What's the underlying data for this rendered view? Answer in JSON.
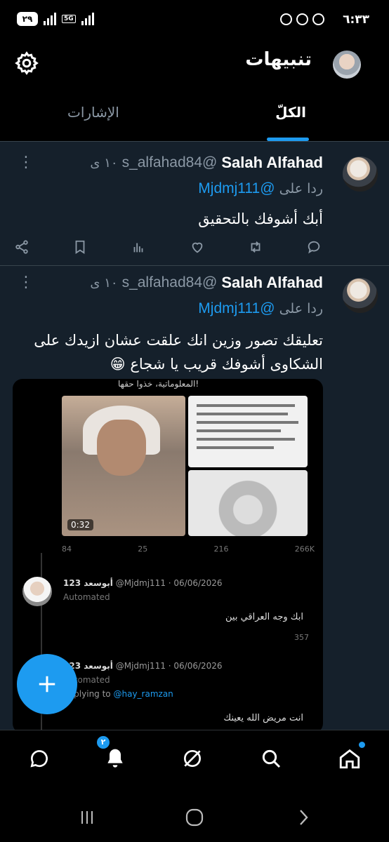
{
  "status_bar": {
    "time": "٦:٣٣",
    "battery": "٢٩",
    "network_label": "5G",
    "left_icons": [
      "alarm-icon",
      "whatsapp-icon",
      "whatsapp-icon"
    ]
  },
  "header": {
    "title": "تنبيهات",
    "tabs": [
      {
        "label": "الكلّ",
        "active": true
      },
      {
        "label": "الإشارات",
        "active": false
      }
    ]
  },
  "tweets": [
    {
      "name": "Salah Alfahad",
      "handle": "@s_alfahad84",
      "time": "١٠ ی",
      "reply_prefix": "ردا على",
      "reply_to": "@Mjdmj111",
      "text": "أبك أشوفك بالتحقيق",
      "actions": [
        "reply-icon",
        "retweet-icon",
        "like-icon",
        "views-icon",
        "bookmark-icon",
        "share-icon"
      ]
    },
    {
      "name": "Salah Alfahad",
      "handle": "@s_alfahad84",
      "time": "١٠ ی",
      "reply_prefix": "ردا على",
      "reply_to": "@Mjdmj111",
      "text": "تعليقك تصور  وزين انك علقت عشان ازيدك على الشكاوى أشوفك قريب يا شجاع 😁",
      "media": {
        "top_line": "المعلوماتية، خذوا حقها!",
        "video_time": "0:32",
        "stats": [
          "84",
          "25",
          "216",
          "266K"
        ],
        "sub_tweets": [
          {
            "name": "أبوسعد 123",
            "handle_date": "@Mjdmj111 · 06/06/2026",
            "automated": "Automated",
            "text": "ابك وجه العراقي بين",
            "stats": [
              "",
              "",
              "",
              "357"
            ]
          },
          {
            "name": "أبوسعد 123",
            "handle_date": "@Mjdmj111 · 06/06/2026",
            "automated": "Automated",
            "replying_prefix": "Replying to",
            "replying_to": "@hay_ramzan",
            "text": "انت مريض الله يعينك"
          }
        ]
      }
    }
  ],
  "fab": {
    "icon": "plus-icon"
  },
  "bottom_nav": {
    "items": [
      {
        "icon": "home-icon",
        "has_dot": true
      },
      {
        "icon": "search-icon"
      },
      {
        "icon": "grok-icon"
      },
      {
        "icon": "notifications-icon",
        "badge": "٢"
      },
      {
        "icon": "messages-icon"
      }
    ]
  },
  "colors": {
    "background": "#15202b",
    "accent": "#1d9bf0",
    "secondary_text": "#8b98a5",
    "divider": "#38444d"
  }
}
